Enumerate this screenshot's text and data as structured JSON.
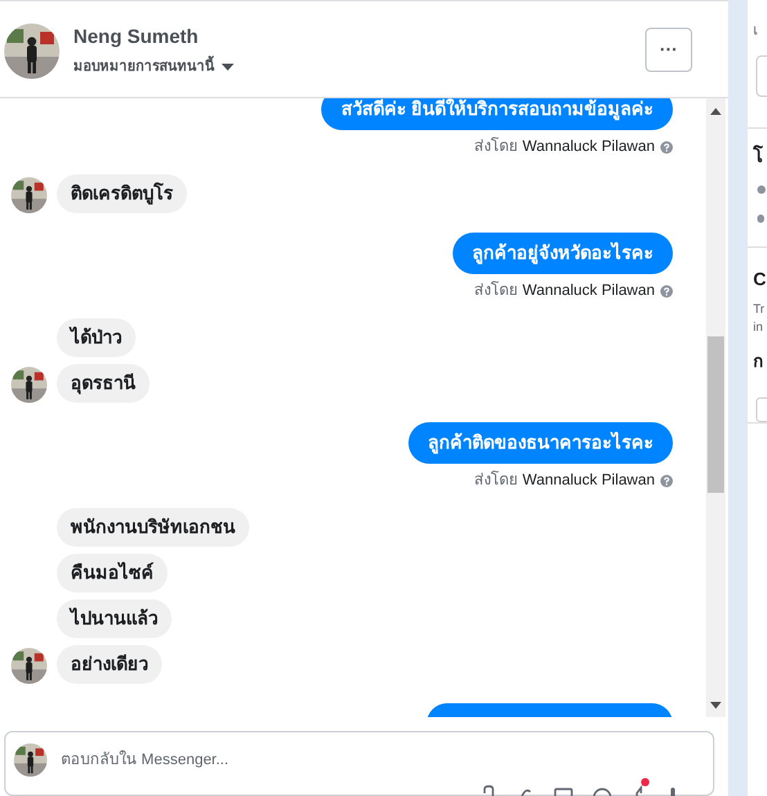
{
  "header": {
    "name": "Neng Sumeth",
    "assign_label": "มอบหมายการสนทนานี้",
    "more_button": "···"
  },
  "messages": [
    {
      "kind": "outgoing",
      "text": "สวัสดีค่ะ  ยินดีให้บริการสอบถามข้อมูลค่ะ",
      "sent_by_label": "ส่งโดย",
      "sender": "Wannaluck Pilawan"
    },
    {
      "kind": "incoming",
      "text": "ติดเครดิตบูโร",
      "avatar": true
    },
    {
      "kind": "outgoing",
      "text": "ลูกค้าอยู่จังหวัดอะไรคะ",
      "sent_by_label": "ส่งโดย",
      "sender": "Wannaluck Pilawan"
    },
    {
      "kind": "incoming",
      "text": "ได้ป่าว",
      "avatar": false
    },
    {
      "kind": "incoming",
      "text": "อุดรธานี",
      "avatar": true
    },
    {
      "kind": "outgoing",
      "text": "ลูกค้าติดของธนาคารอะไรคะ",
      "sent_by_label": "ส่งโดย",
      "sender": "Wannaluck Pilawan"
    },
    {
      "kind": "incoming",
      "text": "พนักงานบริษัทเอกชน",
      "avatar": false
    },
    {
      "kind": "incoming",
      "text": "คืนมอไซค์",
      "avatar": false
    },
    {
      "kind": "incoming",
      "text": "ไปนานแล้ว",
      "avatar": false
    },
    {
      "kind": "incoming",
      "text": "อย่างเดียว",
      "avatar": true
    },
    {
      "kind": "outgoing_cut"
    }
  ],
  "composer": {
    "placeholder": "ตอบกลับใน Messenger..."
  },
  "right_panel": {
    "texts": [
      "เ",
      "โ",
      "C",
      "Tr",
      "in",
      "ก"
    ]
  }
}
